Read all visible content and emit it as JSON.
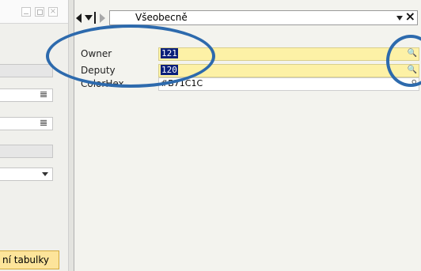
{
  "left_window": {
    "controls": {
      "close_glyph": "×"
    },
    "field_glyph": "𝌆",
    "button_label": "ní tabulky"
  },
  "toolbar": {
    "tab_value": "Všeobecně",
    "close_glyph": "×"
  },
  "fields": [
    {
      "label": "Owner",
      "value": "121",
      "highlight": true,
      "icon": "search-icon",
      "glyph": "🔍"
    },
    {
      "label": "Deputy",
      "value": "120",
      "highlight": true,
      "icon": "search-icon",
      "glyph": "🔍"
    },
    {
      "label": "ColorHex",
      "value": "#B71C1C",
      "highlight": false,
      "icon": "pin-icon",
      "glyph": "⚲"
    }
  ],
  "colors": {
    "annotation": "#2d6aad",
    "highlight_field": "#fdf1a6",
    "selection": "#0a1f7a",
    "left_button": "#fde49a"
  }
}
